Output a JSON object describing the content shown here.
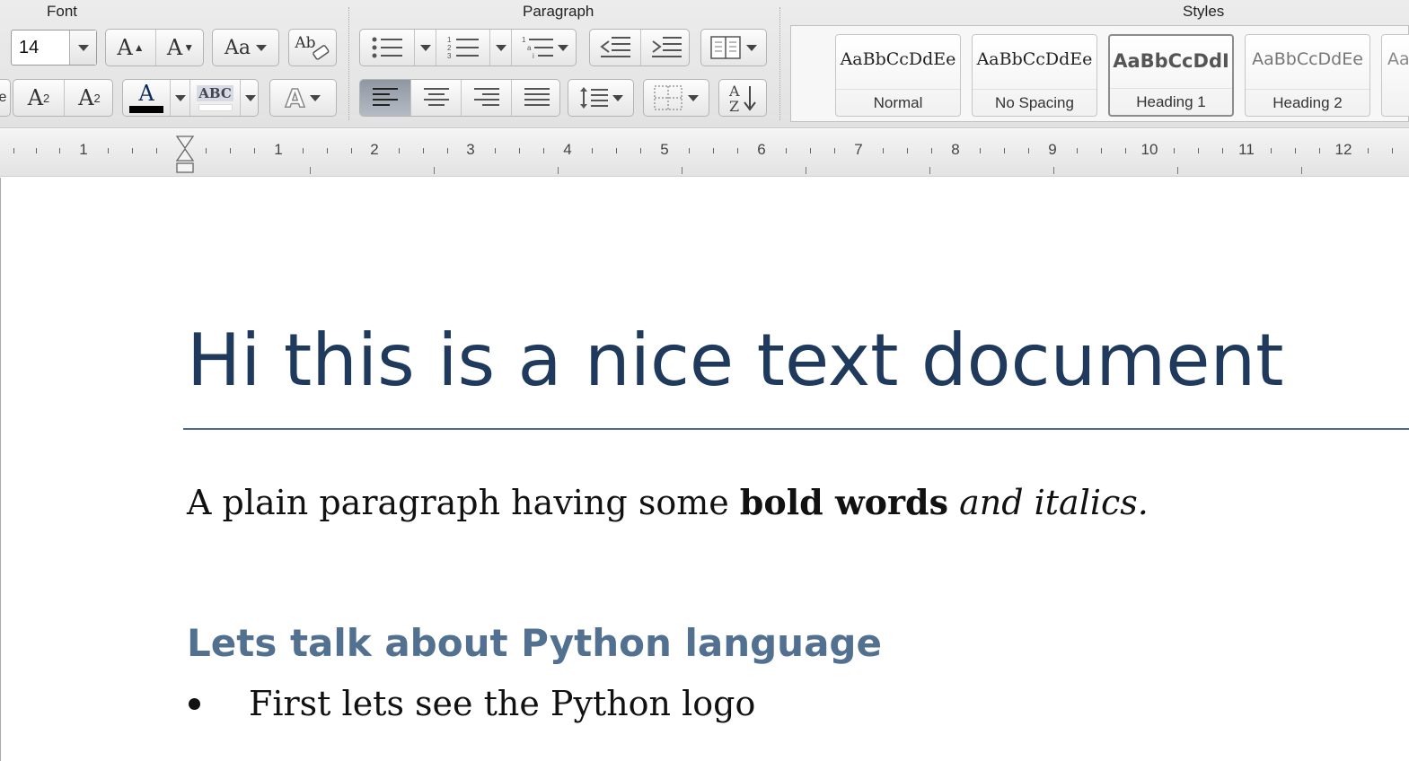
{
  "ribbon": {
    "groups": {
      "font": "Font",
      "paragraph": "Paragraph",
      "styles": "Styles"
    },
    "font": {
      "size_value": "14",
      "grow_label": "A",
      "shrink_label": "A",
      "change_case_label": "Aa",
      "clear_formatting_label": "Ab",
      "superscript_base": "A",
      "superscript_exp": "2",
      "subscript_base": "A",
      "subscript_exp": "2",
      "font_color_label": "A",
      "font_color": "#000000",
      "highlight_label": "ABC",
      "text_effects_label": "A"
    },
    "styles": [
      {
        "preview": "AaBbCcDdEe",
        "name": "Normal",
        "color": "#222222"
      },
      {
        "preview": "AaBbCcDdEe",
        "name": "No Spacing",
        "color": "#222222"
      },
      {
        "preview": "AaBbCcDdI",
        "name": "Heading 1",
        "color": "#555555",
        "selected": true
      },
      {
        "preview": "AaBbCcDdEe",
        "name": "Heading 2",
        "color": "#777777"
      }
    ]
  },
  "ruler": {
    "numbers": [
      "1",
      "1",
      "2",
      "3",
      "4",
      "5",
      "6",
      "7",
      "8",
      "9",
      "10",
      "11",
      "12"
    ]
  },
  "document": {
    "title": "Hi this is a nice text document",
    "paragraph": {
      "plain": "A plain paragraph having some ",
      "bold": "bold words",
      "italic": " and italics."
    },
    "heading": "Lets talk about Python language",
    "bullets": [
      "First lets see the Python logo"
    ]
  }
}
